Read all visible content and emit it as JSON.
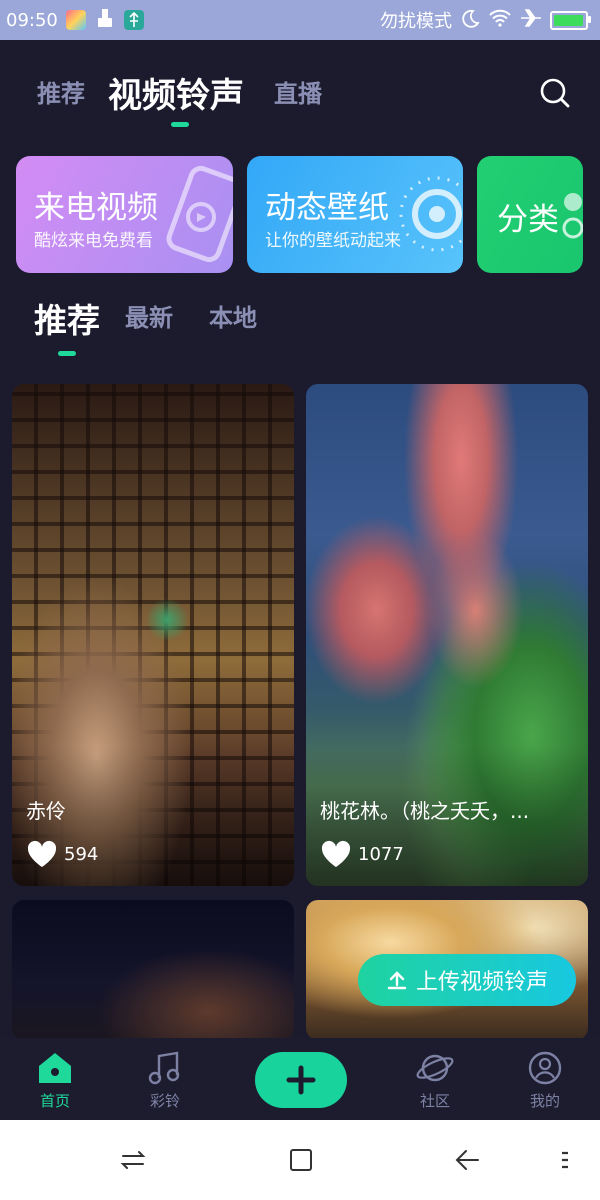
{
  "status_bar": {
    "time": "09:50",
    "dnd_label": "勿扰模式"
  },
  "header": {
    "tabs": [
      {
        "label": "推荐"
      },
      {
        "label": "视频铃声"
      },
      {
        "label": "直播"
      }
    ],
    "active_tab": "视频铃声"
  },
  "cards": [
    {
      "title": "来电视频",
      "subtitle": "酷炫来电免费看"
    },
    {
      "title": "动态壁纸",
      "subtitle": "让你的壁纸动起来"
    },
    {
      "title": "分类",
      "subtitle": ""
    }
  ],
  "sub_tabs": [
    {
      "label": "推荐"
    },
    {
      "label": "最新"
    },
    {
      "label": "本地"
    }
  ],
  "videos": [
    {
      "title": "赤伶",
      "likes": "594"
    },
    {
      "title": "桃花林。（桃之夭夭，...",
      "likes": "1077"
    },
    {
      "title": "",
      "likes": ""
    },
    {
      "title": "",
      "likes": ""
    }
  ],
  "upload_button": {
    "label": "上传视频铃声"
  },
  "bottom_nav": {
    "items": [
      {
        "label": "首页",
        "icon": "home-icon"
      },
      {
        "label": "彩铃",
        "icon": "music-icon"
      },
      {
        "label": "",
        "icon": "plus-icon"
      },
      {
        "label": "社区",
        "icon": "planet-icon"
      },
      {
        "label": "我的",
        "icon": "user-icon"
      }
    ],
    "active": "首页"
  },
  "colors": {
    "accent": "#1ed999",
    "background": "#1c1b2e"
  }
}
